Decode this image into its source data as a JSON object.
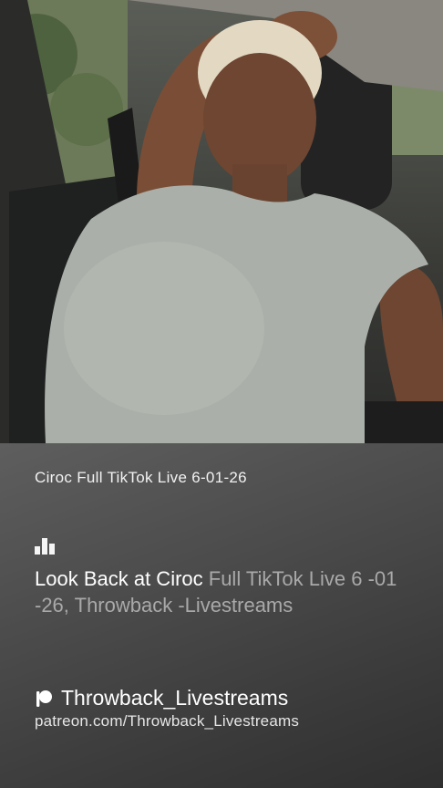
{
  "video": {
    "description_icon": "video-frame"
  },
  "caption": "Ciroc Full TikTok Live 6-01-26",
  "stats_icon": "bar-chart-icon",
  "headline": {
    "highlight": "Look Back at Ciroc",
    "rest": " Full TikTok Live 6 -01 -26, Throwback -Livestreams"
  },
  "creator": {
    "icon": "patreon-icon",
    "name": "Throwback_Livestreams",
    "url": "patreon.com/Throwback_Livestreams"
  },
  "colors": {
    "panel_top": "#5e5e5e",
    "panel_bottom": "#2f2f2f",
    "text_primary": "#ffffff",
    "text_muted": "#a9a9a9"
  }
}
